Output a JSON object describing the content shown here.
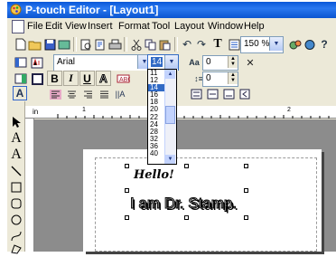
{
  "window": {
    "title": "P-touch Editor - [Layout1]"
  },
  "menu": {
    "items": [
      {
        "label": "File"
      },
      {
        "label": "Edit"
      },
      {
        "label": "View"
      },
      {
        "label": "Insert"
      },
      {
        "label": "Format"
      },
      {
        "label": "Tool"
      },
      {
        "label": "Layout"
      },
      {
        "label": "Window"
      },
      {
        "label": "Help"
      }
    ]
  },
  "toolbar": {
    "zoom": "150 %",
    "text_tool_glyph": "T"
  },
  "format_bar": {
    "font": "Arial",
    "size": "14",
    "bold": "B",
    "italic": "I",
    "underline": "U",
    "outline": "A",
    "spin_top": "0",
    "spin_bottom": "0"
  },
  "size_dropdown": {
    "options": [
      "11",
      "12",
      "14",
      "16",
      "18",
      "20",
      "22",
      "24",
      "28",
      "32",
      "36",
      "40"
    ],
    "selected": "14"
  },
  "palette": {
    "text_glyph": "A",
    "vtext_glyph": "A"
  },
  "label": {
    "line1": "Hello!",
    "line2": "I am Dr. Stamp."
  },
  "ruler": {
    "unit": "in",
    "marks": [
      "1",
      "2"
    ]
  },
  "colors": {
    "titlebar": "#0a58d8",
    "selection": "#316ac5",
    "canvas": "#8c8c8c"
  }
}
